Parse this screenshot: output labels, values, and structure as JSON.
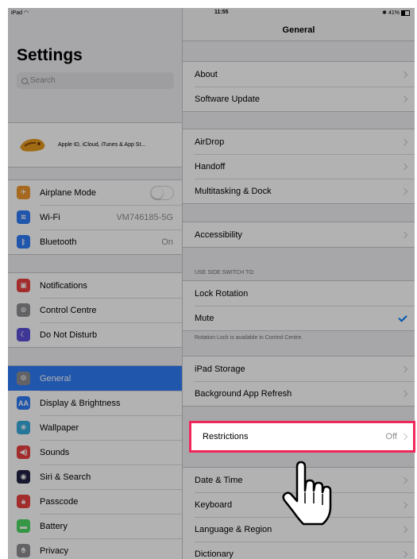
{
  "status_bar": {
    "device": "iPad",
    "time": "11:55",
    "battery": "41%"
  },
  "master": {
    "title": "Settings",
    "search_placeholder": "Search",
    "profile_label": "Apple ID, iCloud, iTunes & App St...",
    "groups": [
      [
        {
          "label": "Airplane Mode",
          "icon": "airplane-icon",
          "color": "#f0962e",
          "control": "toggle"
        },
        {
          "label": "Wi-Fi",
          "icon": "wifi-icon",
          "color": "#2f7cf6",
          "value": "VM746185-5G"
        },
        {
          "label": "Bluetooth",
          "icon": "bluetooth-icon",
          "color": "#2f7cf6",
          "value": "On"
        }
      ],
      [
        {
          "label": "Notifications",
          "icon": "notifications-icon",
          "color": "#e9413f"
        },
        {
          "label": "Control Centre",
          "icon": "control-centre-icon",
          "color": "#8e8e93"
        },
        {
          "label": "Do Not Disturb",
          "icon": "moon-icon",
          "color": "#5b4fd6"
        }
      ],
      [
        {
          "label": "General",
          "icon": "gear-icon",
          "color": "#8e8e93",
          "selected": true
        },
        {
          "label": "Display & Brightness",
          "icon": "display-icon",
          "color": "#2f7cf6",
          "glyph": "AA"
        },
        {
          "label": "Wallpaper",
          "icon": "wallpaper-icon",
          "color": "#36aadc"
        },
        {
          "label": "Sounds",
          "icon": "speaker-icon",
          "color": "#e9413f"
        },
        {
          "label": "Siri & Search",
          "icon": "siri-icon",
          "color": "#222244"
        },
        {
          "label": "Passcode",
          "icon": "lock-icon",
          "color": "#e9413f"
        },
        {
          "label": "Battery",
          "icon": "battery-icon",
          "color": "#4cd964"
        },
        {
          "label": "Privacy",
          "icon": "hand-icon",
          "color": "#8e8e93"
        }
      ]
    ]
  },
  "detail": {
    "title": "General",
    "group1": [
      "About",
      "Software Update"
    ],
    "group2": [
      "AirDrop",
      "Handoff",
      "Multitasking & Dock"
    ],
    "group3": [
      "Accessibility"
    ],
    "side_switch_header": "USE SIDE SWITCH TO:",
    "side_switch_options": [
      {
        "label": "Lock Rotation",
        "checked": false
      },
      {
        "label": "Mute",
        "checked": true
      }
    ],
    "side_switch_footer": "Rotation Lock is available in Control Centre.",
    "group5": [
      "iPad Storage",
      "Background App Refresh"
    ],
    "restrictions": {
      "label": "Restrictions",
      "value": "Off"
    },
    "group7": [
      "Date & Time",
      "Keyboard",
      "Language & Region",
      "Dictionary"
    ]
  },
  "colors": {
    "accent": "#2f7cf6",
    "highlight_border": "#f0275a",
    "check": "#007aff"
  }
}
